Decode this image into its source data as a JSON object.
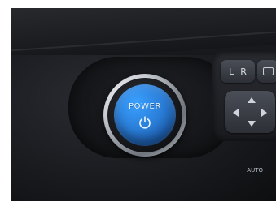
{
  "power_button": {
    "label": "POWER",
    "icon": "power-icon",
    "accent_color": "#2a7ed8"
  },
  "controls": {
    "lr_button": {
      "left_label": "L",
      "right_label": "R"
    },
    "mini_button_icon": "rect-icon",
    "dpad_icon": "dpad-icon"
  },
  "auto_badge": {
    "label": "AUTO"
  }
}
